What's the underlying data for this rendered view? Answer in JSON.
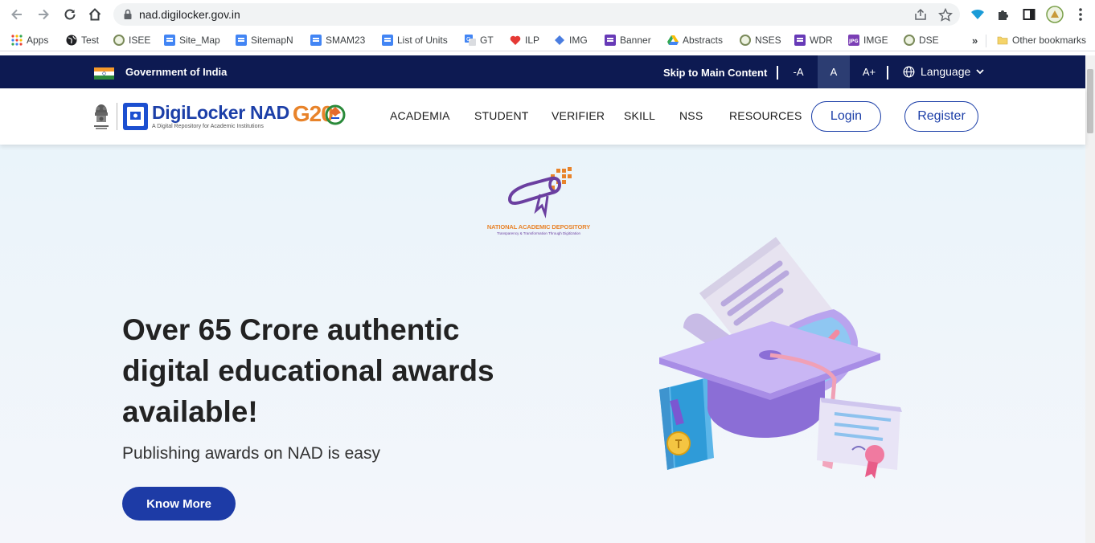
{
  "browser": {
    "url": "nad.digilocker.gov.in",
    "bookmarks": [
      {
        "label": "Apps",
        "icon": "apps-grid-icon"
      },
      {
        "label": "Test",
        "icon": "globe-icon"
      },
      {
        "label": "ISEE",
        "icon": "emblem-icon"
      },
      {
        "label": "Site_Map",
        "icon": "doc-icon"
      },
      {
        "label": "SitemapN",
        "icon": "doc-icon"
      },
      {
        "label": "SMAM23",
        "icon": "doc-icon"
      },
      {
        "label": "List of Units",
        "icon": "doc-icon"
      },
      {
        "label": "GT",
        "icon": "translate-icon"
      },
      {
        "label": "ILP",
        "icon": "heart-icon"
      },
      {
        "label": "IMG",
        "icon": "diamond-icon"
      },
      {
        "label": "Banner",
        "icon": "form-icon"
      },
      {
        "label": "Abstracts",
        "icon": "drive-icon"
      },
      {
        "label": "NSES",
        "icon": "emblem-icon"
      },
      {
        "label": "WDR",
        "icon": "form-icon"
      },
      {
        "label": "IMGE",
        "icon": "jpg-icon"
      },
      {
        "label": "DSE",
        "icon": "emblem-icon"
      }
    ],
    "overflow": "»",
    "other_bookmarks": "Other bookmarks"
  },
  "gov_bar": {
    "title": "Government of India",
    "skip": "Skip to Main Content",
    "font_small": "-A",
    "font_normal": "A",
    "font_large": "A+",
    "language": "Language"
  },
  "header": {
    "logo_title": "DigiLocker NAD",
    "logo_tagline": "A Digital Repository for Academic Institutions",
    "g20": "G20",
    "nav": [
      "ACADEMIA",
      "STUDENT",
      "VERIFIER",
      "SKILL",
      "NSS",
      "RESOURCES"
    ],
    "login": "Login",
    "register": "Register"
  },
  "hero": {
    "badge_title": "NATIONAL ACADEMIC DEPOSITORY",
    "badge_tagline": "Transparency & Transformation Through Digitization",
    "title": "Over 65 Crore authentic digital educational awards available!",
    "subtitle": "Publishing awards on NAD is easy",
    "cta": "Know More"
  },
  "colors": {
    "gov_bar": "#0d1a52",
    "brand_blue": "#1c3fa8",
    "cta": "#1d3ba6",
    "hero_bg": "#eaf4fa",
    "g20_orange": "#e8832a"
  }
}
